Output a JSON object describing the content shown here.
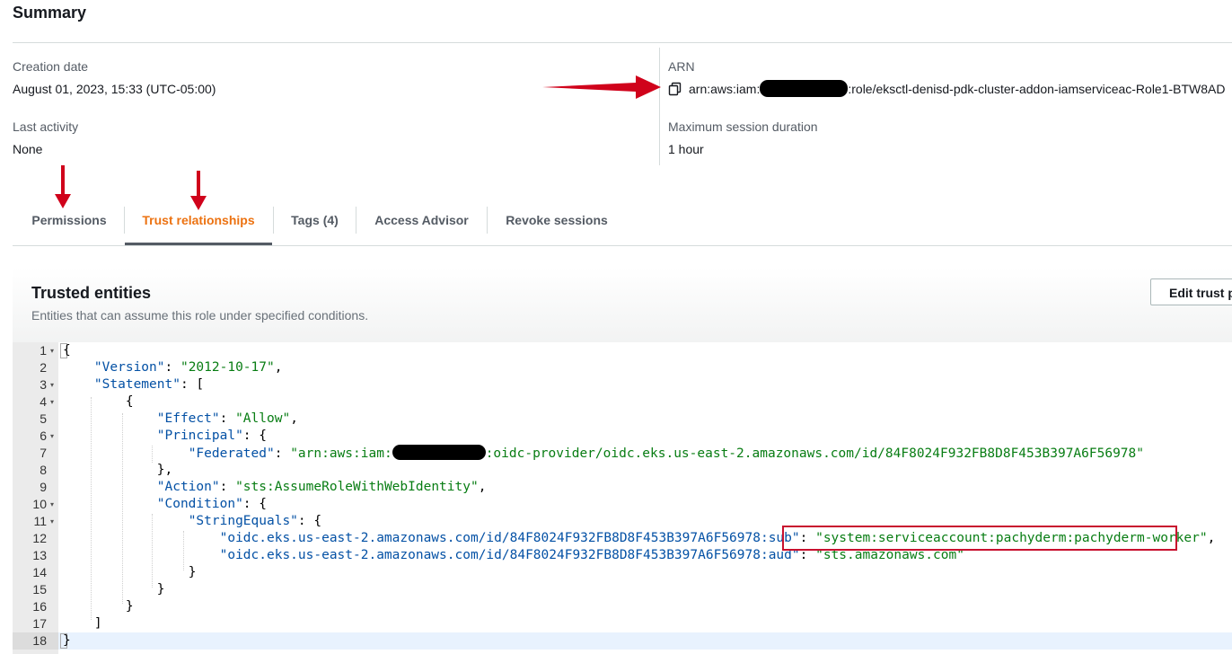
{
  "summary": {
    "title": "Summary",
    "creation_date_label": "Creation date",
    "creation_date_value": "August 01, 2023, 15:33 (UTC-05:00)",
    "last_activity_label": "Last activity",
    "last_activity_value": "None",
    "arn_label": "ARN",
    "arn_prefix": "arn:aws:iam:",
    "arn_suffix": ":role/eksctl-denisd-pdk-cluster-addon-iamserviceac-Role1-BTW8AD",
    "max_session_label": "Maximum session duration",
    "max_session_value": "1 hour"
  },
  "tabs": [
    {
      "label": "Permissions"
    },
    {
      "label": "Trust relationships"
    },
    {
      "label": "Tags (4)"
    },
    {
      "label": "Access Advisor"
    },
    {
      "label": "Revoke sessions"
    }
  ],
  "trusted_entities": {
    "title": "Trusted entities",
    "subtitle": "Entities that can assume this role under specified conditions.",
    "edit_button": "Edit trust p"
  },
  "policy": {
    "line_numbers": [
      "1",
      "2",
      "3",
      "4",
      "5",
      "6",
      "7",
      "8",
      "9",
      "10",
      "11",
      "12",
      "13",
      "14",
      "15",
      "16",
      "17",
      "18"
    ],
    "open_brace": "{",
    "version_key": "\"Version\"",
    "version_value": "\"2012-10-17\"",
    "statement_key": "\"Statement\"",
    "effect_key": "\"Effect\"",
    "effect_value": "\"Allow\"",
    "principal_key": "\"Principal\"",
    "federated_key": "\"Federated\"",
    "federated_prefix": "\"arn:aws:iam:",
    "federated_suffix": ":oidc-provider/oidc.eks.us-east-2.amazonaws.com/id/84F8024F932FB8D8F453B397A6F56978\"",
    "action_key": "\"Action\"",
    "action_value": "\"sts:AssumeRoleWithWebIdentity\"",
    "condition_key": "\"Condition\"",
    "string_equals_key": "\"StringEquals\"",
    "sub_key": "\"oidc.eks.us-east-2.amazonaws.com/id/84F8024F932FB8D8F453B397A6F56978:sub\"",
    "sub_value": "\"system:serviceaccount:pachyderm:pachyderm-worker\"",
    "aud_key": "\"oidc.eks.us-east-2.amazonaws.com/id/84F8024F932FB8D8F453B397A6F56978:aud\"",
    "aud_value": "\"sts.amazonaws.com\""
  },
  "colors": {
    "active_tab": "#ec7211",
    "annotation_red": "#d0021b",
    "json_key": "#0451a5",
    "json_string": "#087d13"
  }
}
